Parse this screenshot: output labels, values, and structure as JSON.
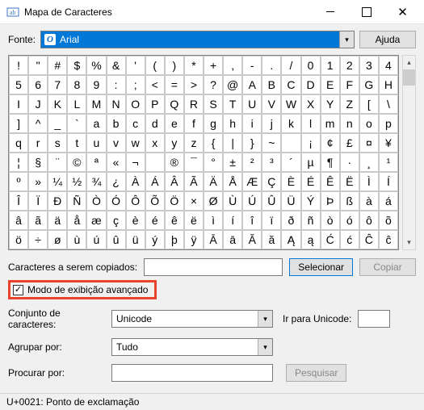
{
  "window": {
    "title": "Mapa de Caracteres",
    "icon_name": "charmap-icon"
  },
  "labels": {
    "font": "Fonte:",
    "help": "Ajuda",
    "copy_chars": "Caracteres a serem copiados:",
    "select": "Selecionar",
    "copy": "Copiar",
    "advanced": "Modo de exibição avançado",
    "charset": "Conjunto de caracteres:",
    "goto_unicode": "Ir para Unicode:",
    "group_by": "Agrupar por:",
    "search_for": "Procurar por:",
    "search_btn": "Pesquisar"
  },
  "font_select": {
    "value": "Arial",
    "icon_glyph": "O"
  },
  "charset_select": {
    "value": "Unicode"
  },
  "group_select": {
    "value": "Tudo"
  },
  "goto_unicode_value": "",
  "search_value": "",
  "copy_value": "",
  "advanced_checked": "✓",
  "grid": [
    "!",
    "\"",
    "#",
    "$",
    "%",
    "&",
    "'",
    "(",
    ")",
    "*",
    "+",
    ",",
    "-",
    ".",
    "/",
    "0",
    "1",
    "2",
    "3",
    "4",
    "5",
    "6",
    "7",
    "8",
    "9",
    ":",
    ";",
    "<",
    "=",
    ">",
    "?",
    "@",
    "A",
    "B",
    "C",
    "D",
    "E",
    "F",
    "G",
    "H",
    "I",
    "J",
    "K",
    "L",
    "M",
    "N",
    "O",
    "P",
    "Q",
    "R",
    "S",
    "T",
    "U",
    "V",
    "W",
    "X",
    "Y",
    "Z",
    "[",
    "\\",
    "]",
    "^",
    "_",
    "`",
    "a",
    "b",
    "c",
    "d",
    "e",
    "f",
    "g",
    "h",
    "i",
    "j",
    "k",
    "l",
    "m",
    "n",
    "o",
    "p",
    "q",
    "r",
    "s",
    "t",
    "u",
    "v",
    "w",
    "x",
    "y",
    "z",
    "{",
    "|",
    "}",
    "~",
    "",
    "¡",
    "¢",
    "£",
    "¤",
    "¥",
    "¦",
    "§",
    "¨",
    "©",
    "ª",
    "«",
    "¬",
    "­",
    "®",
    "¯",
    "°",
    "±",
    "²",
    "³",
    "´",
    "µ",
    "¶",
    "·",
    "¸",
    "¹",
    "º",
    "»",
    "¼",
    "½",
    "¾",
    "¿",
    "À",
    "Á",
    "Â",
    "Ã",
    "Ä",
    "Å",
    "Æ",
    "Ç",
    "È",
    "É",
    "Ê",
    "Ë",
    "Ì",
    "Í",
    "Î",
    "Ï",
    "Ð",
    "Ñ",
    "Ò",
    "Ó",
    "Ô",
    "Õ",
    "Ö",
    "×",
    "Ø",
    "Ù",
    "Ú",
    "Û",
    "Ü",
    "Ý",
    "Þ",
    "ß",
    "à",
    "á",
    "â",
    "ã",
    "ä",
    "å",
    "æ",
    "ç",
    "è",
    "é",
    "ê",
    "ë",
    "ì",
    "í",
    "î",
    "ï",
    "ð",
    "ñ",
    "ò",
    "ó",
    "ô",
    "õ",
    "ö",
    "÷",
    "ø",
    "ù",
    "ú",
    "û",
    "ü",
    "ý",
    "þ",
    "ÿ",
    "Ā",
    "ā",
    "Ă",
    "ă",
    "Ą",
    "ą",
    "Ć",
    "ć",
    "Ĉ",
    "ĉ"
  ],
  "status": "U+0021: Ponto de exclamação"
}
